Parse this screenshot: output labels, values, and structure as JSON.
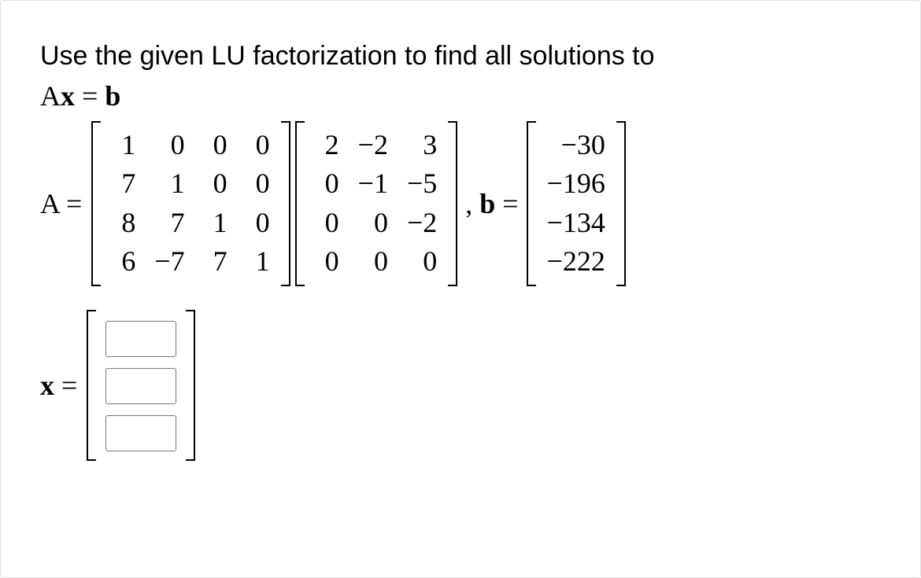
{
  "prompt": "Use the given LU factorization to find all solutions to",
  "equation_lhs": "Ax = b",
  "labels": {
    "A_eq": "A =",
    "b_eq": ", b =",
    "x_eq": "x ="
  },
  "L": [
    [
      "1",
      "0",
      "0",
      "0"
    ],
    [
      "7",
      "1",
      "0",
      "0"
    ],
    [
      "8",
      "7",
      "1",
      "0"
    ],
    [
      "6",
      "−7",
      "7",
      "1"
    ]
  ],
  "U": [
    [
      "2",
      "−2",
      "3"
    ],
    [
      "0",
      "−1",
      "−5"
    ],
    [
      "0",
      "0",
      "−2"
    ],
    [
      "0",
      "0",
      "0"
    ]
  ],
  "b": [
    "−30",
    "−196",
    "−134",
    "−222"
  ],
  "x_inputs": [
    "",
    "",
    ""
  ],
  "chart_data": {
    "type": "table",
    "title": "LU factorization system Ax = b",
    "series": [
      {
        "name": "L",
        "values": [
          [
            1,
            0,
            0,
            0
          ],
          [
            7,
            1,
            0,
            0
          ],
          [
            8,
            7,
            1,
            0
          ],
          [
            6,
            -7,
            7,
            1
          ]
        ]
      },
      {
        "name": "U",
        "values": [
          [
            2,
            -2,
            3
          ],
          [
            0,
            -1,
            -5
          ],
          [
            0,
            0,
            -2
          ],
          [
            0,
            0,
            0
          ]
        ]
      },
      {
        "name": "b",
        "values": [
          -30,
          -196,
          -134,
          -222
        ]
      }
    ]
  }
}
